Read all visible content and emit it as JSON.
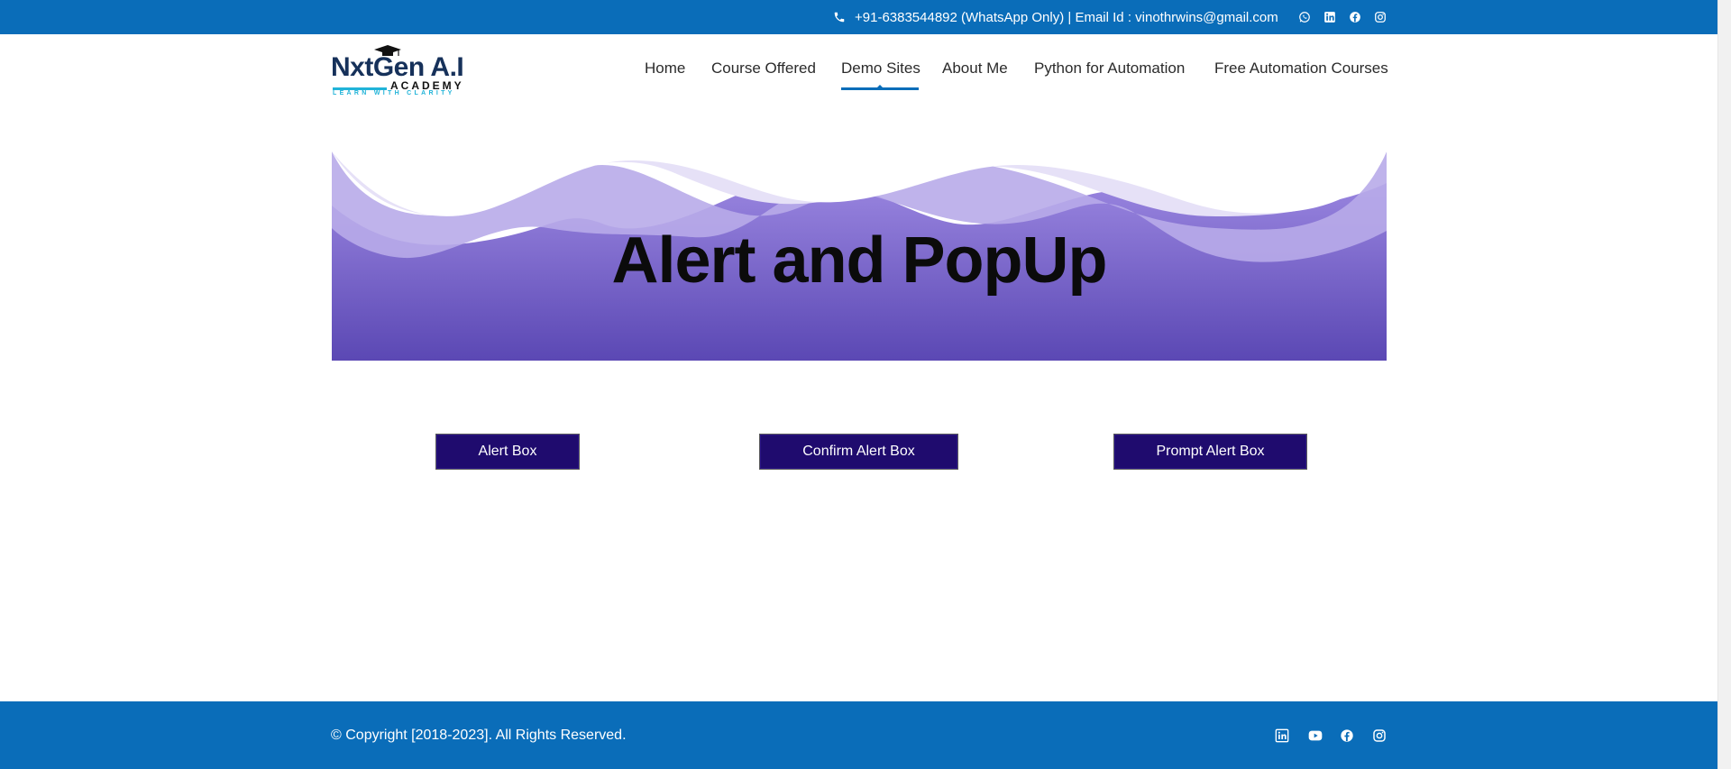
{
  "topbar": {
    "contact_text": "+91-6383544892 (WhatsApp Only) | Email Id : vinothrwins@gmail.com",
    "icons": [
      "whatsapp-icon",
      "linkedin-icon",
      "facebook-icon",
      "instagram-icon"
    ]
  },
  "logo": {
    "line1": "NxtGen A.I",
    "line2": "ACADEMY",
    "line3": "LEARN WITH CLARITY"
  },
  "nav": {
    "items": [
      "Home",
      "Course Offered",
      "Demo Sites",
      "About Me",
      "Python for Automation",
      "Free Automation Courses"
    ],
    "active": "Demo Sites"
  },
  "hero": {
    "title": "Alert and PopUp"
  },
  "buttons": {
    "alert": "Alert Box",
    "confirm": "Confirm Alert Box",
    "prompt": "Prompt Alert Box"
  },
  "footer": {
    "copyright": "© Copyright [2018-2023]. All Rights Reserved.",
    "icons": [
      "linkedin-icon",
      "youtube-icon",
      "facebook-icon",
      "instagram-icon"
    ]
  },
  "colors": {
    "brand_blue": "#0a6db9",
    "button_bg": "#1f0b6e",
    "hero_purple": "#6a55c4"
  }
}
